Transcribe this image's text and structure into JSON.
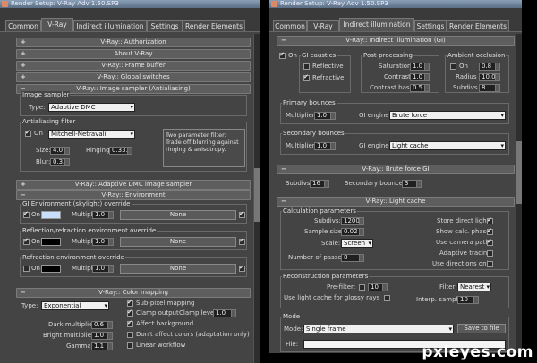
{
  "left": {
    "title": "Render Setup: V-Ray Adv 1.50.SP3",
    "tabs": [
      "Common",
      "V-Ray",
      "Indirect illumination",
      "Settings",
      "Render Elements"
    ],
    "rollouts": {
      "authorization": "V-Ray:: Authorization",
      "about": "About V-Ray",
      "framebuffer": "V-Ray:: Frame buffer",
      "global": "V-Ray:: Global switches",
      "imagesampler": "V-Ray:: Image sampler (Antialiasing)",
      "dmc": "V-Ray:: Adaptive DMC image sampler",
      "environment": "V-Ray:: Environment",
      "colormapping": "V-Ray:: Color mapping"
    },
    "signs": {
      "minus": "−",
      "plus": "+"
    },
    "image_sampler": {
      "group": "Image sampler",
      "type_label": "Type:",
      "type_value": "Adaptive DMC"
    },
    "aa_filter": {
      "group": "Antialiasing filter",
      "on_label": "On",
      "filter_value": "Mitchell-Netravali",
      "note": "Two parameter filter: Trade off blurring against ringing & anisotropy.",
      "size_label": "Size:",
      "size_value": "4.0",
      "ringing_label": "Ringing:",
      "ringing_value": "0.333",
      "blur_label": "Blur:",
      "blur_value": "0.333"
    },
    "environment": {
      "gi_group": "GI Environment (skylight) override",
      "refl_group": "Reflection/refraction environment override",
      "refr_group": "Refraction environment override",
      "on_label": "On",
      "multiplier_label": "Multiplier:",
      "multiplier_value": "1.0",
      "none_label": "None",
      "gi_color": "#c8defa",
      "refl_color": "#000000",
      "refr_color": "#000000"
    },
    "color_mapping": {
      "type_label": "Type:",
      "type_value": "Exponential",
      "dark_label": "Dark multiplier:",
      "dark_value": "0.6",
      "bright_label": "Bright multiplier:",
      "bright_value": "1.0",
      "gamma_label": "Gamma:",
      "gamma_value": "1.1",
      "subpixel": "Sub-pixel mapping",
      "clamp": "Clamp output",
      "clamp_level_label": "Clamp level:",
      "clamp_level_value": "1.0",
      "affect_bg": "Affect background",
      "dont_affect": "Don't affect colors (adaptation only)",
      "linear": "Linear workflow"
    }
  },
  "right": {
    "title": "Render Setup: V-Ray Adv 1.50.SP3",
    "tabs": [
      "Common",
      "V-Ray",
      "Indirect illumination",
      "Settings",
      "Render Elements"
    ],
    "rollouts": {
      "indirect": "V-Ray:: Indirect illumination (GI)",
      "bruteforce": "V-Ray:: Brute force GI",
      "lightcache": "V-Ray:: Light cache"
    },
    "signs": {
      "minus": "−"
    },
    "gi": {
      "on_label": "On",
      "caustics_group": "GI caustics",
      "reflective": "Reflective",
      "refractive": "Refractive",
      "post_group": "Post-processing",
      "saturation_label": "Saturation",
      "saturation_value": "1.0",
      "contrast_label": "Contrast",
      "contrast_value": "1.0",
      "contrast_base_label": "Contrast base",
      "contrast_base_value": "0.5",
      "ao_group": "Ambient occlusion",
      "ao_on": "On",
      "ao_on_value": "0.8",
      "radius_label": "Radius",
      "radius_value": "10.0cm",
      "subdivs_label": "Subdivs",
      "subdivs_value": "8",
      "primary_group": "Primary bounces",
      "primary_mult_label": "Multiplier",
      "primary_mult_value": "1.0",
      "primary_engine_label": "GI engine",
      "primary_engine_value": "Brute force",
      "secondary_group": "Secondary bounces",
      "secondary_mult_label": "Multiplier",
      "secondary_mult_value": "1.0",
      "secondary_engine_label": "GI engine",
      "secondary_engine_value": "Light cache"
    },
    "brute": {
      "subdivs_label": "Subdivs:",
      "subdivs_value": "16",
      "bounces_label": "Secondary bounces:",
      "bounces_value": "3"
    },
    "light_cache": {
      "calc_group": "Calculation parameters",
      "subdivs_label": "Subdivs:",
      "subdivs_value": "1200",
      "sample_label": "Sample size:",
      "sample_value": "0.02",
      "scale_label": "Scale:",
      "scale_value": "Screen",
      "passes_label": "Number of passes:",
      "passes_value": "8",
      "store_direct": "Store direct light",
      "show_calc": "Show calc. phase",
      "camera_path": "Use camera path",
      "adaptive": "Adaptive tracing",
      "dirs_only": "Use directions only",
      "recon_group": "Reconstruction parameters",
      "prefilter_label": "Pre-filter:",
      "prefilter_value": "10",
      "glossy": "Use light cache for glossy rays",
      "filter_label": "Filter:",
      "filter_value": "Nearest",
      "interp_label": "Interp. samples:",
      "interp_value": "10",
      "mode_group": "Mode",
      "mode_label": "Mode:",
      "mode_value": "Single frame",
      "save_label": "Save to file",
      "file_label": "File:"
    }
  },
  "watermark": "pxleyes.com"
}
